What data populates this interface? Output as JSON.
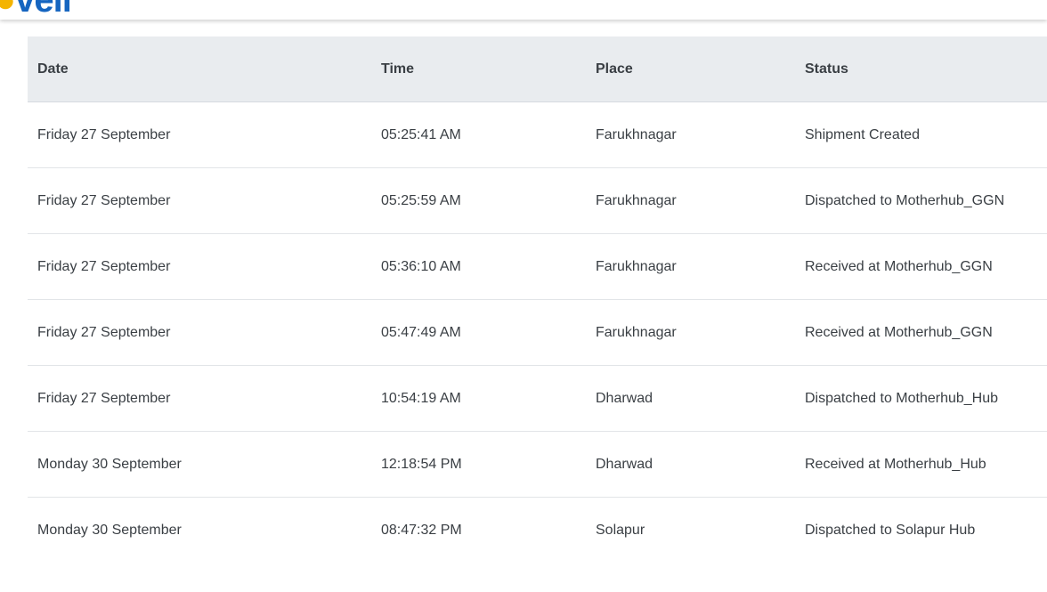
{
  "tracking": {
    "columns": [
      "Date",
      "Time",
      "Place",
      "Status"
    ],
    "rows": [
      {
        "date": "Friday 27 September",
        "time": "05:25:41 AM",
        "place": "Farukhnagar",
        "status": "Shipment Created"
      },
      {
        "date": "Friday 27 September",
        "time": "05:25:59 AM",
        "place": "Farukhnagar",
        "status": "Dispatched to Motherhub_GGN"
      },
      {
        "date": "Friday 27 September",
        "time": "05:36:10 AM",
        "place": "Farukhnagar",
        "status": "Received at Motherhub_GGN"
      },
      {
        "date": "Friday 27 September",
        "time": "05:47:49 AM",
        "place": "Farukhnagar",
        "status": "Received at Motherhub_GGN"
      },
      {
        "date": "Friday 27 September",
        "time": "10:54:19 AM",
        "place": "Dharwad",
        "status": "Dispatched to Motherhub_Hub"
      },
      {
        "date": "Monday 30 September",
        "time": "12:18:54 PM",
        "place": "Dharwad",
        "status": "Received at Motherhub_Hub"
      },
      {
        "date": "Monday 30 September",
        "time": "08:47:32 PM",
        "place": "Solapur",
        "status": "Dispatched to Solapur Hub"
      }
    ]
  },
  "colors": {
    "header_bg": "#e9ecef",
    "text": "#3a3f44",
    "brand": "#1565c0",
    "brand_accent": "#f4b400"
  }
}
